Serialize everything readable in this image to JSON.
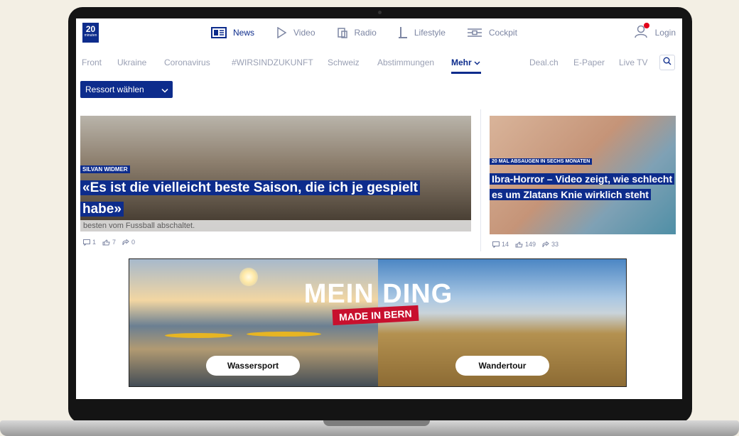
{
  "logo": {
    "line1": "20",
    "line2": "minuten"
  },
  "main_nav": [
    {
      "label": "News",
      "icon": "newspaper-icon"
    },
    {
      "label": "Video",
      "icon": "play-icon"
    },
    {
      "label": "Radio",
      "icon": "radio-icon"
    },
    {
      "label": "Lifestyle",
      "icon": "lifestyle-icon"
    },
    {
      "label": "Cockpit",
      "icon": "cockpit-icon"
    }
  ],
  "login": {
    "label": "Login",
    "icon": "user-icon"
  },
  "sub_nav": [
    "Front",
    "Ukraine",
    "Coronavirus",
    "#WIRSINDZUKUNFT",
    "Schweiz",
    "Abstimmungen",
    "Mehr",
    "Deal.ch",
    "E-Paper",
    "Live TV"
  ],
  "ressort_button": "Ressort wählen",
  "articles": [
    {
      "kicker": "SILVAN WIDMER",
      "headline": "«Es ist die vielleicht beste Saison, die ich je gespielt habe»",
      "lead": "besten vom Fussball abschaltet.",
      "comments": "1",
      "likes": "7",
      "shares": "0"
    },
    {
      "kicker": "20 MAL ABSAUGEN IN SECHS MONATEN",
      "headline": "Ibra-Horror – Video zeigt, wie schlecht es um Zlatans Knie wirklich steht",
      "comments": "14",
      "likes": "149",
      "shares": "33"
    }
  ],
  "banner": {
    "title": "MEIN DING",
    "subtitle": "MADE IN BERN",
    "buttons": [
      "Wassersport",
      "Wandertour"
    ]
  },
  "colors": {
    "brand": "#0d2c8c",
    "alert": "#e2001a",
    "banner_accent": "#c8102e"
  }
}
